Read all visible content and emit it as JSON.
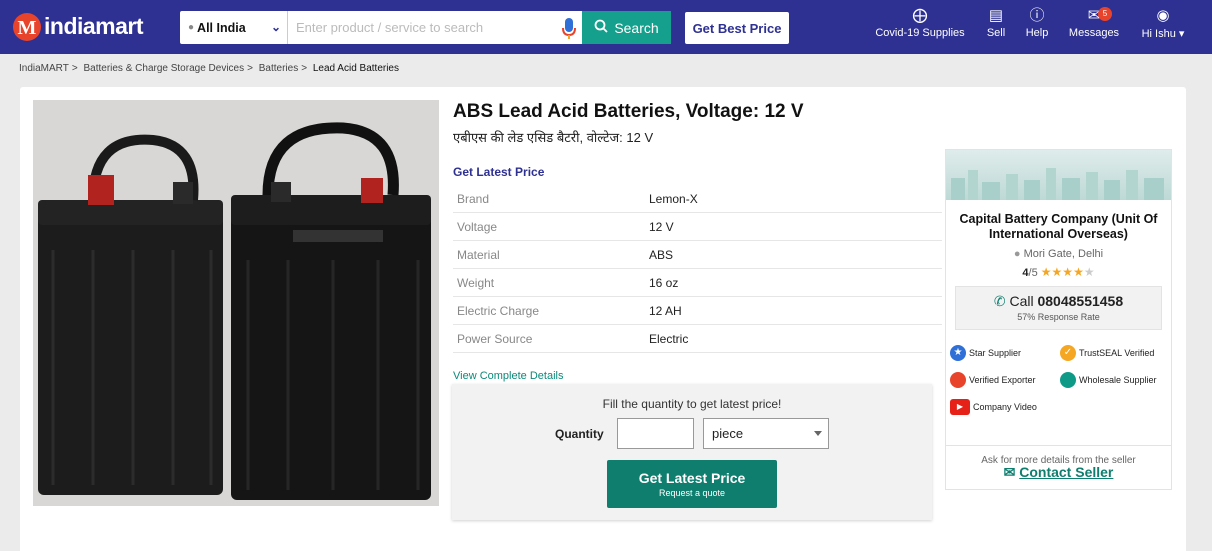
{
  "header": {
    "logo_text": "indiamart",
    "location": "All India",
    "search_placeholder": "Enter product / service to search",
    "search_button": "Search",
    "best_price_button": "Get Best Price",
    "nav": [
      {
        "label": "Covid-19 Supplies",
        "icon": "shield-plus-icon"
      },
      {
        "label": "Sell",
        "icon": "store-icon"
      },
      {
        "label": "Help",
        "icon": "help-icon"
      },
      {
        "label": "Messages",
        "icon": "messages-icon",
        "badge": "5"
      },
      {
        "label": "Hi Ishu",
        "icon": "user-icon"
      }
    ]
  },
  "breadcrumb": [
    "IndiaMART",
    "Batteries & Charge Storage Devices",
    "Batteries",
    "Lead Acid Batteries"
  ],
  "product": {
    "title": "ABS Lead Acid Batteries, Voltage: 12 V",
    "subtitle_hindi": "एबीएस की लेड एसिड बैटरी, वोल्टेज: 12 V",
    "get_latest_price_link": "Get Latest Price",
    "specs": [
      {
        "key": "Brand",
        "value": "Lemon-X"
      },
      {
        "key": "Voltage",
        "value": "12 V"
      },
      {
        "key": "Material",
        "value": "ABS"
      },
      {
        "key": "Weight",
        "value": "16 oz"
      },
      {
        "key": "Electric Charge",
        "value": "12 AH"
      },
      {
        "key": "Power Source",
        "value": "Electric"
      }
    ],
    "view_details": "View Complete Details"
  },
  "quantity_box": {
    "title": "Fill the quantity to get latest price!",
    "label": "Quantity",
    "quantity_value": "",
    "unit": "piece",
    "button_line1": "Get Latest Price",
    "button_line2": "Request a quote"
  },
  "seller": {
    "name": "Capital Battery Company (Unit Of International Overseas)",
    "location": "Mori Gate, Delhi",
    "rating": "4",
    "rating_of": "/5",
    "stars_filled": 4,
    "stars_total": 5,
    "call_prefix": "Call",
    "phone": "08048551458",
    "response_rate": "57% Response Rate",
    "badges": [
      "Star Supplier",
      "TrustSEAL Verified",
      "Verified Exporter",
      "Wholesale Supplier",
      "Company Video"
    ],
    "ask_text": "Ask for more details from the seller",
    "contact_label": "Contact Seller"
  },
  "colors": {
    "header_bg": "#2e3192",
    "accent_teal": "#14a08c",
    "button_teal": "#0f7e6f",
    "star": "#f5a623"
  }
}
